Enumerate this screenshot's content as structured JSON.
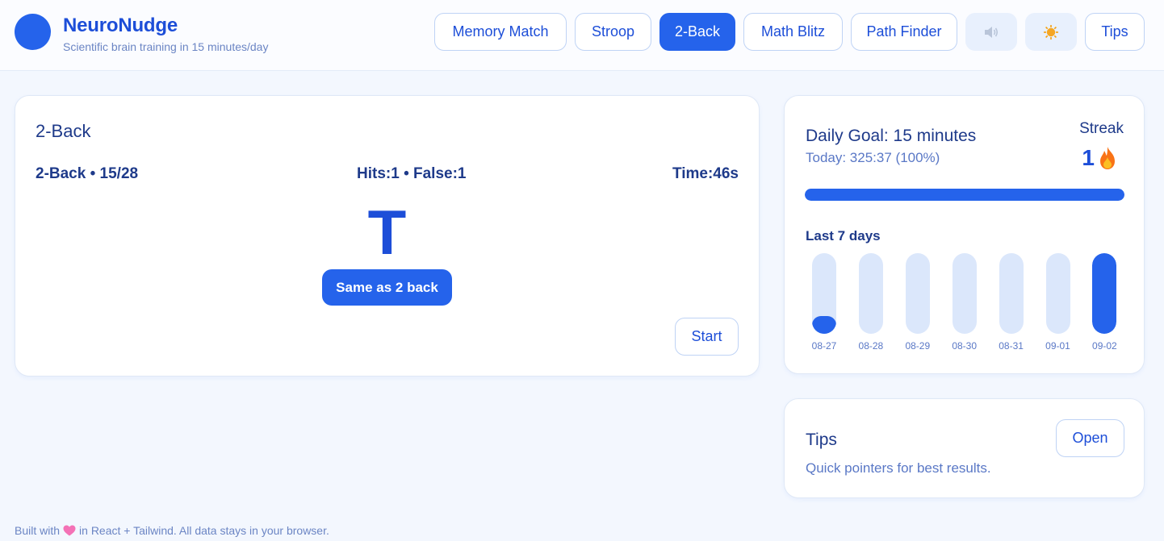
{
  "brand": {
    "title": "NeuroNudge",
    "subtitle": "Scientific brain training in 15 minutes/day",
    "accent": "#2563eb"
  },
  "nav": {
    "memory_match": "Memory Match",
    "stroop": "Stroop",
    "two_back": "2-Back",
    "math_blitz": "Math Blitz",
    "path_finder": "Path Finder",
    "sound_icon": "speaker-icon",
    "theme_icon": "sun-icon",
    "tips": "Tips"
  },
  "game": {
    "title": "2-Back",
    "progress": "2-Back • 15/28",
    "score": "Hits:1 • False:1",
    "time": "Time:46s",
    "stimulus": "T",
    "match_button": "Same as 2 back",
    "start_button": "Start"
  },
  "goal": {
    "title": "Daily Goal: 15 minutes",
    "today": "Today: 325:37 (100%)",
    "progress_fraction": 1.0,
    "streak_label": "Streak",
    "streak_value": "1",
    "week_label": "Last 7 days",
    "days": [
      {
        "label": "08-27",
        "fraction": 0.22
      },
      {
        "label": "08-28",
        "fraction": 0
      },
      {
        "label": "08-29",
        "fraction": 0
      },
      {
        "label": "08-30",
        "fraction": 0
      },
      {
        "label": "08-31",
        "fraction": 0
      },
      {
        "label": "09-01",
        "fraction": 0
      },
      {
        "label": "09-02",
        "fraction": 1.0
      }
    ]
  },
  "tips": {
    "title": "Tips",
    "subtitle": "Quick pointers for best results.",
    "open_button": "Open"
  },
  "footer": {
    "before_heart": "Built with",
    "after_heart": "in React + Tailwind. All data stays in your browser."
  }
}
